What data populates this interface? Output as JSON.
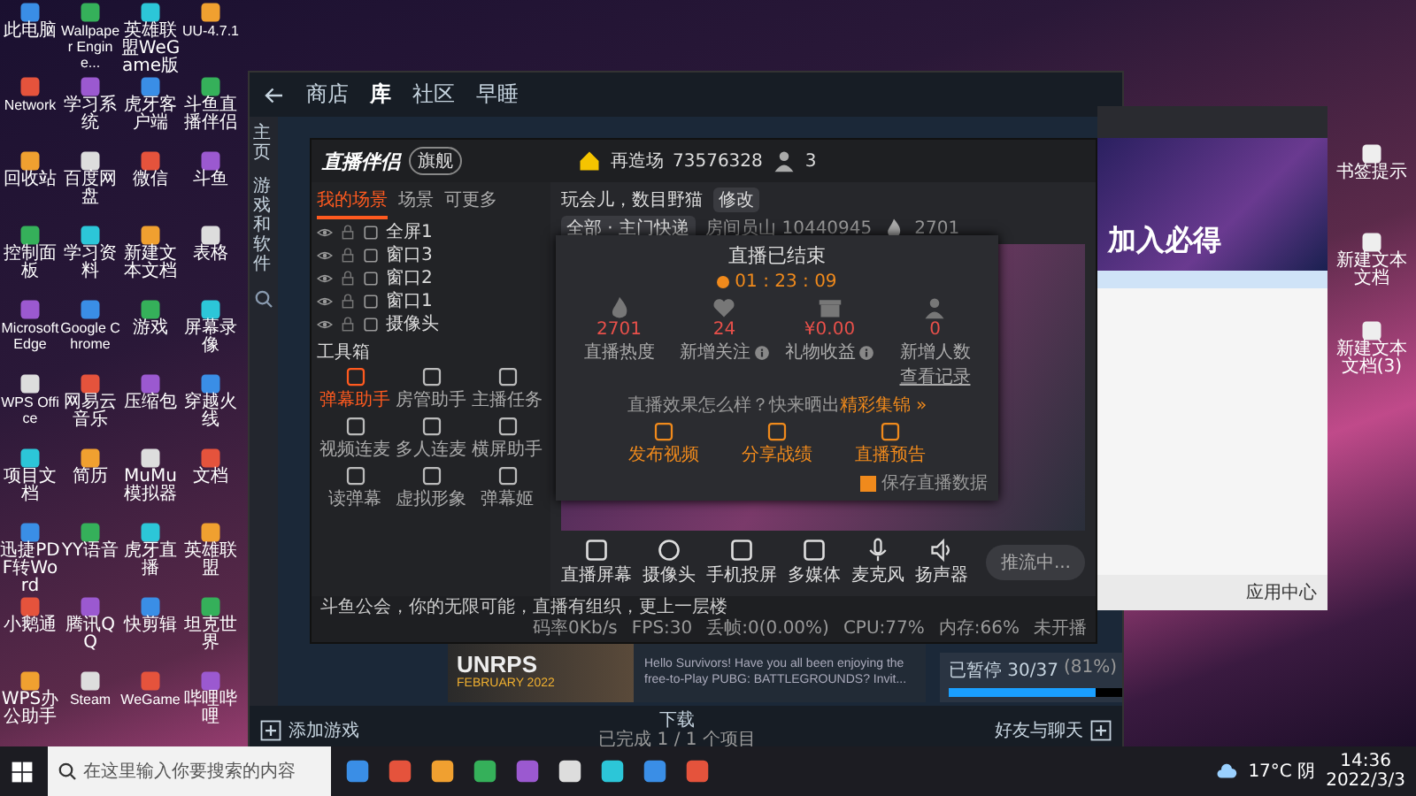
{
  "desktop_icons": [
    {
      "label": "此电脑"
    },
    {
      "label": "Network"
    },
    {
      "label": "回收站"
    },
    {
      "label": "控制面板"
    },
    {
      "label": "Microsoft Edge"
    },
    {
      "label": "WPS Office"
    },
    {
      "label": "项目文档"
    },
    {
      "label": "迅捷PDF转Word"
    },
    {
      "label": "小鹅通"
    },
    {
      "label": "WPS办公助手"
    },
    {
      "label": "Wallpaper Engine..."
    },
    {
      "label": "学习系统"
    },
    {
      "label": "百度网盘"
    },
    {
      "label": "学习资料"
    },
    {
      "label": "Google Chrome"
    },
    {
      "label": "网易云音乐"
    },
    {
      "label": "简历"
    },
    {
      "label": "YY语音"
    },
    {
      "label": "腾讯QQ"
    },
    {
      "label": "Steam"
    },
    {
      "label": "英雄联盟WeGame版"
    },
    {
      "label": "虎牙客户端"
    },
    {
      "label": "微信"
    },
    {
      "label": "新建文本文档"
    },
    {
      "label": "游戏"
    },
    {
      "label": "压缩包"
    },
    {
      "label": "MuMu模拟器"
    },
    {
      "label": "虎牙直播"
    },
    {
      "label": "快剪辑"
    },
    {
      "label": "WeGame"
    },
    {
      "label": "UU-4.7.1"
    },
    {
      "label": "斗鱼直播伴侣"
    },
    {
      "label": "斗鱼"
    },
    {
      "label": "表格"
    },
    {
      "label": "屏幕录像"
    },
    {
      "label": "穿越火线"
    },
    {
      "label": "文档"
    },
    {
      "label": "英雄联盟"
    },
    {
      "label": "坦克世界"
    },
    {
      "label": "哔哩哔哩"
    }
  ],
  "right_icons": [
    {
      "label": "书签提示"
    },
    {
      "label": "新建文本文档"
    },
    {
      "label": "新建文本文档(3)"
    }
  ],
  "steam": {
    "nav": [
      {
        "label": "商店",
        "selected": false
      },
      {
        "label": "库",
        "selected": true
      },
      {
        "label": "社区",
        "selected": false
      },
      {
        "label": "早睡",
        "selected": false
      }
    ],
    "sidebar": [
      {
        "label": "主页"
      },
      {
        "label": "游戏和软件"
      }
    ],
    "news": {
      "banner_title": "UNRPS",
      "banner_date": "FEBRUARY 2022",
      "text": "Hello Survivors! Have you all been enjoying the free-to-Play PUBG: BATTLEGROUNDS? Invit..."
    },
    "download": {
      "label": "已暂停 30/37",
      "percent": "(81%)",
      "level": 0.81
    },
    "footer": {
      "add_game": "添加游戏",
      "downloads": "下载",
      "downloads_sub": "已完成 1 / 1 个项目",
      "friends": "好友与聊天"
    }
  },
  "companion": {
    "logo": "直播伴侣",
    "badge": "旗舰",
    "room_name": "再造场",
    "room_id": "73576328",
    "viewers": "3",
    "scene_tabs": [
      {
        "label": "我的场景",
        "selected": true
      },
      {
        "label": "场景",
        "selected": false
      },
      {
        "label": "可更多",
        "selected": false
      }
    ],
    "sources": [
      {
        "label": "全屏1"
      },
      {
        "label": "窗口3"
      },
      {
        "label": "窗口2"
      },
      {
        "label": "窗口1"
      },
      {
        "label": "摄像头"
      }
    ],
    "toolbox_title": "工具箱",
    "tools": [
      {
        "label": "弹幕助手",
        "active": true
      },
      {
        "label": "房管助手",
        "active": false
      },
      {
        "label": "主播任务",
        "active": false
      },
      {
        "label": "视频连麦",
        "active": false
      },
      {
        "label": "多人连麦",
        "active": false
      },
      {
        "label": "横屏助手",
        "active": false
      },
      {
        "label": "读弹幕",
        "active": false
      },
      {
        "label": "虚拟形象",
        "active": false
      },
      {
        "label": "弹幕姬",
        "active": false
      }
    ],
    "stream_title": "玩会儿，数目野猫",
    "title_tag": "修改",
    "category": "全部 · 主门快递",
    "room_label": "房间员山 10440945",
    "heat": "2701",
    "controls": [
      {
        "label": "直播屏幕"
      },
      {
        "label": "摄像头"
      },
      {
        "label": "手机投屏"
      },
      {
        "label": "多媒体"
      },
      {
        "label": "麦克风"
      },
      {
        "label": "扬声器"
      }
    ],
    "stream_button": "推流中...",
    "notice": "斗鱼公会，你的无限可能，直播有组织，更上一层楼",
    "stats": [
      "码率0Kb/s",
      "FPS:30",
      "丢帧:0(0.00%)",
      "CPU:77%",
      "内存:66%",
      "未开播"
    ]
  },
  "dialog": {
    "title": "直播已结束",
    "duration": "01 : 23 : 09",
    "metrics": [
      {
        "value": "2701",
        "label": "直播热度",
        "info": false
      },
      {
        "value": "24",
        "label": "新增关注",
        "info": true
      },
      {
        "value": "¥0.00",
        "label": "礼物收益",
        "info": true
      },
      {
        "value": "0",
        "label": "新增人数",
        "info": false,
        "link": "查看记录"
      }
    ],
    "promo": "直播效果怎么样？快来晒出",
    "promo_link": "精彩集锦 »",
    "actions": [
      {
        "label": "发布视频"
      },
      {
        "label": "分享战绩"
      },
      {
        "label": "直播预告"
      }
    ],
    "save": {
      "label": "保存直播数据",
      "checked": true
    }
  },
  "client": {
    "banner": "加入必得",
    "app_center": "应用中心"
  },
  "taskbar": {
    "search": {
      "placeholder": "在这里输入你要搜索的内容"
    },
    "weather": "17°C 阴",
    "time": "14:36",
    "date": "2022/3/3"
  }
}
